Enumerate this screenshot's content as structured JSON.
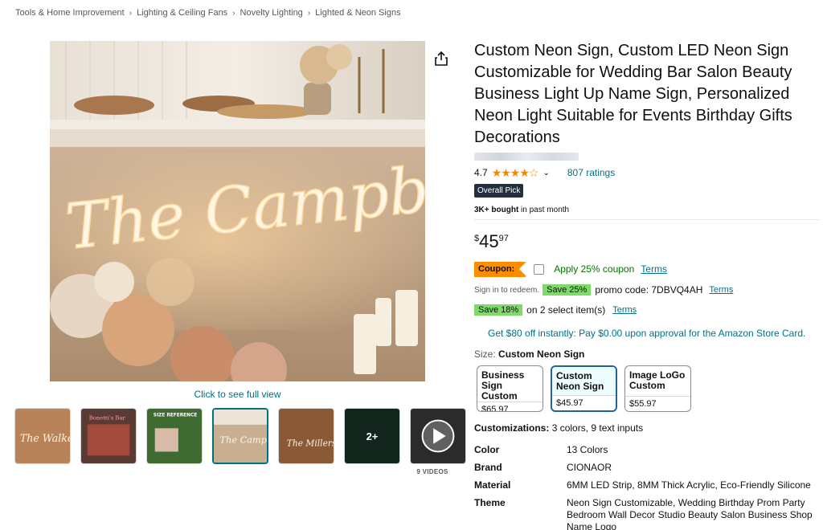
{
  "breadcrumb": [
    "Tools & Home Improvement",
    "Lighting & Ceiling Fans",
    "Novelty Lighting",
    "Lighted & Neon Signs"
  ],
  "image": {
    "see_full_view": "Click to see full view",
    "neon_text": "The Campbells",
    "thumbnails": [
      {
        "label": "The Walkers"
      },
      {
        "label": "Bonetti's Bar"
      },
      {
        "label": "SIZE REFERENCE"
      },
      {
        "label": "The Campbells"
      },
      {
        "label": "The Millers"
      },
      {
        "label": "2+"
      },
      {
        "label": "video"
      }
    ],
    "videos_label": "9 VIDEOS"
  },
  "product": {
    "title": "Custom Neon Sign, Custom LED Neon Sign Customizable for Wedding Bar Salon Beauty Business Light Up Name Sign, Personalized Neon Light Suitable for Events Birthday Gifts Decorations",
    "rating": "4.7",
    "stars": "★★★★☆",
    "ratings_count": "807 ratings",
    "badge": "Overall Pick",
    "bought_bold": "3K+ bought",
    "bought_rest": " in past month",
    "price": {
      "currency": "$",
      "whole": "45",
      "fraction": "97"
    },
    "coupon": {
      "tag": "Coupon:",
      "apply": "Apply 25% coupon",
      "terms": "Terms"
    },
    "promo": {
      "sign_in": "Sign in to redeem.",
      "save": "Save 25%",
      "code": "promo code: 7DBVQ4AH",
      "terms": "Terms"
    },
    "save18": {
      "tag": "Save 18%",
      "text": "on 2 select item(s)",
      "terms": "Terms"
    },
    "store_card": "Get $80 off instantly: Pay $0.00 upon approval for the Amazon Store Card.",
    "size": {
      "label": "Size:",
      "selected": "Custom Neon Sign",
      "options": [
        {
          "name": "Business Sign Custom",
          "price": "$65.97"
        },
        {
          "name": "Custom Neon Sign",
          "price": "$45.97"
        },
        {
          "name": "Image LoGo Custom",
          "price": "$55.97"
        }
      ]
    },
    "customizations": {
      "label": "Customizations:",
      "value": "3 colors, 9 text inputs"
    },
    "specs": [
      {
        "key": "Color",
        "value": "13 Colors"
      },
      {
        "key": "Brand",
        "value": "CIONAOR"
      },
      {
        "key": "Material",
        "value": "6MM LED Strip, 8MM Thick Acrylic, Eco-Friendly Silicone"
      },
      {
        "key": "Theme",
        "value": "Neon Sign Customizable, Wedding Birthday Prom Party Bedroom Wall Decor Studio Beauty Salon Business Shop Name Logo"
      }
    ]
  },
  "colors": {
    "link": "#007185",
    "coupon": "#ff8d00",
    "green_tag": "#7fda69",
    "star": "#f08804",
    "badge": "#232f3e"
  }
}
